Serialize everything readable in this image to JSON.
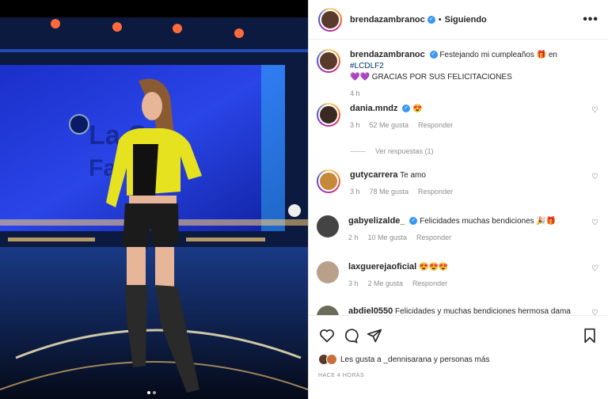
{
  "post": {
    "username": "brendazambranoc",
    "follow_status": "Siguiendo",
    "caption_user": "brendazambranoc",
    "caption_text": "Festejando mi cumpleaños 🎁 en",
    "caption_hashtag": "#LCDLF2",
    "caption_line2": "💜💜 GRACIAS POR SUS FELICITACIONES",
    "caption_time": "4 h",
    "more_label": "•••"
  },
  "comments": [
    {
      "user": "dania.mndz",
      "verified": true,
      "text": "😍",
      "time": "3 h",
      "likes": "52 Me gusta",
      "reply": "Responder"
    },
    {
      "user": "gutycarrera",
      "verified": false,
      "text": "Te amo",
      "time": "3 h",
      "likes": "78 Me gusta",
      "reply": "Responder"
    },
    {
      "user": "gabyelizalde_",
      "verified": true,
      "text": "Felicidades muchas bendiciones 🎉🎁",
      "time": "2 h",
      "likes": "10 Me gusta",
      "reply": "Responder"
    },
    {
      "user": "laxguerejaoficial",
      "verified": false,
      "text": "😍😍😍",
      "time": "3 h",
      "likes": "2 Me gusta",
      "reply": "Responder"
    },
    {
      "user": "abdiel0550",
      "verified": false,
      "text": "Felicidades y muchas bendiciones hermosa dama",
      "time": "",
      "likes": "",
      "reply": ""
    }
  ],
  "view_replies": "Ver respuestas (1)",
  "liked_by": "Les gusta a _dennisarana y personas más",
  "post_date": "HACE 4 HORAS",
  "colors": {
    "verified": "#3897f0",
    "hashtag": "#00376b",
    "muted": "#8e8e8e"
  }
}
